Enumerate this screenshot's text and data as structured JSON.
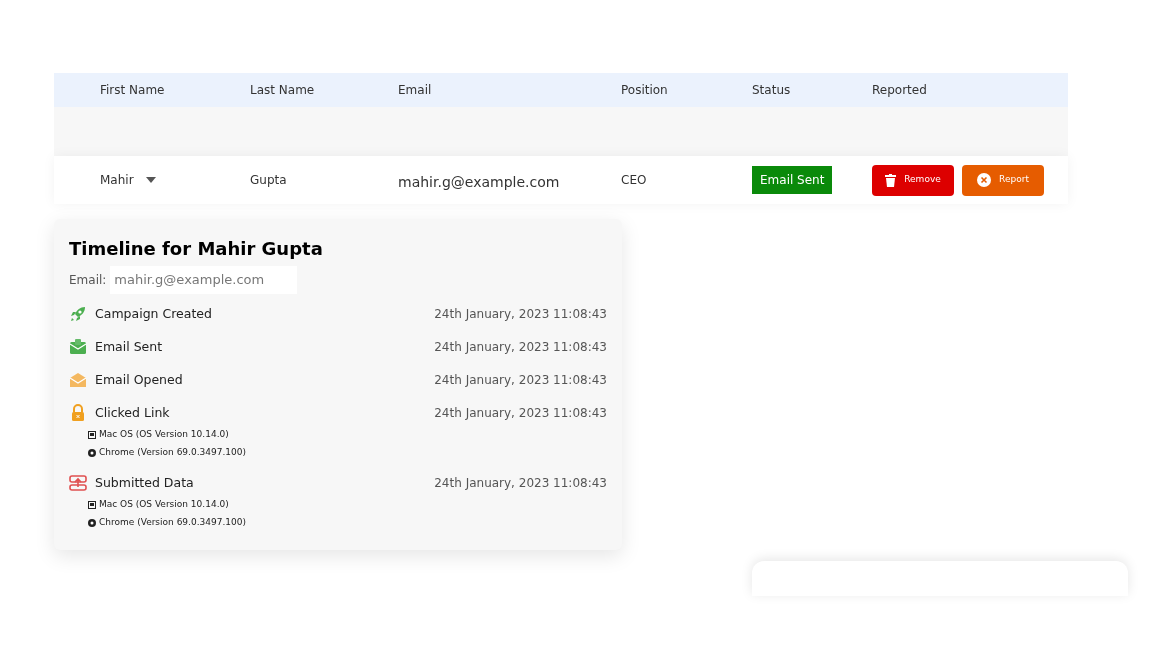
{
  "table": {
    "columns": [
      "First Name",
      "Last Name",
      "Email",
      "Position",
      "Status",
      "Reported"
    ],
    "rows": [
      {
        "first_name": "Mahir",
        "expanded": false,
        "last_name": "Gupta",
        "email": "mahir.g@example.com",
        "position": "CEO",
        "status": "Email Sent",
        "actions": [
          {
            "kind": "remove",
            "label": "Remove"
          },
          {
            "kind": "report",
            "label": "Report"
          }
        ]
      }
    ]
  },
  "timeline": {
    "title": "Timeline for Mahir Gupta",
    "email_label": "Email:",
    "email": "mahir.g@example.com",
    "events": [
      {
        "kind": "created",
        "label": "Campaign Created",
        "time": "24th January, 2023 11:08:43"
      },
      {
        "kind": "sent",
        "label": "Email Sent",
        "time": "24th January, 2023 11:08:43"
      },
      {
        "kind": "opened",
        "label": "Email Opened",
        "time": "24th January, 2023 11:08:43"
      },
      {
        "kind": "clicked",
        "label": "Clicked Link",
        "time": "24th January, 2023 11:08:43",
        "details": [
          {
            "kind": "os",
            "text": "Mac OS (OS Version 10.14.0)"
          },
          {
            "kind": "browser",
            "text": "Chrome (Version 69.0.3497.100)"
          }
        ]
      },
      {
        "kind": "submitted",
        "label": "Submitted Data",
        "time": "24th January, 2023 11:08:43",
        "details": [
          {
            "kind": "os",
            "text": "Mac OS (OS Version 10.14.0)"
          },
          {
            "kind": "browser",
            "text": "Chrome (Version 69.0.3497.100)"
          }
        ]
      }
    ]
  }
}
